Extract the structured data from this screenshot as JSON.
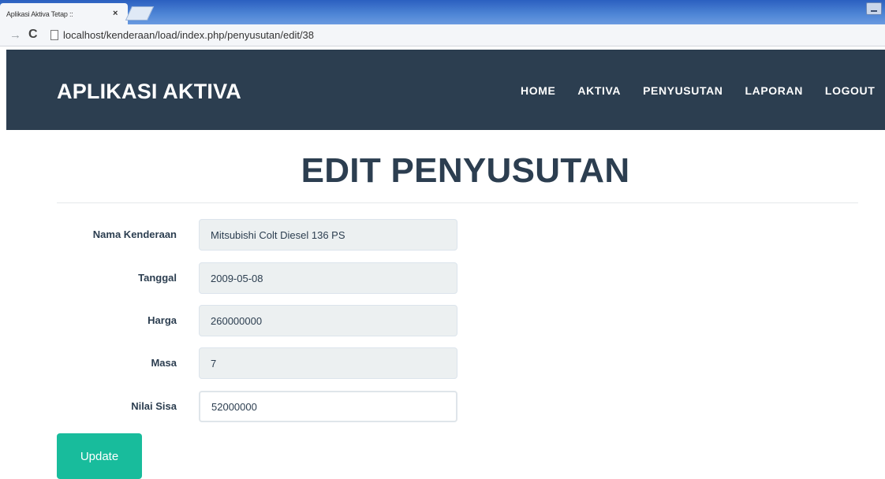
{
  "browser": {
    "tab_title": "Aplikasi Aktiva Tetap ::",
    "tab_close": "×",
    "url": "localhost/kenderaan/load/index.php/penyusutan/edit/38"
  },
  "navbar": {
    "brand": "APLIKASI AKTIVA",
    "links": [
      "HOME",
      "AKTIVA",
      "PENYUSUTAN",
      "LAPORAN",
      "LOGOUT"
    ],
    "background": "#2c3e50"
  },
  "main": {
    "title": "EDIT PENYUSUTAN",
    "fields": [
      {
        "label": "Nama Kenderaan",
        "value": "Mitsubishi Colt Diesel 136 PS",
        "readonly": true
      },
      {
        "label": "Tanggal",
        "value": "2009-05-08",
        "readonly": true
      },
      {
        "label": "Harga",
        "value": "260000000",
        "readonly": true
      },
      {
        "label": "Masa",
        "value": "7",
        "readonly": true
      },
      {
        "label": "Nilai Sisa",
        "value": "52000000",
        "readonly": false
      }
    ],
    "update_label": "Update",
    "accent": "#18bc9c"
  }
}
